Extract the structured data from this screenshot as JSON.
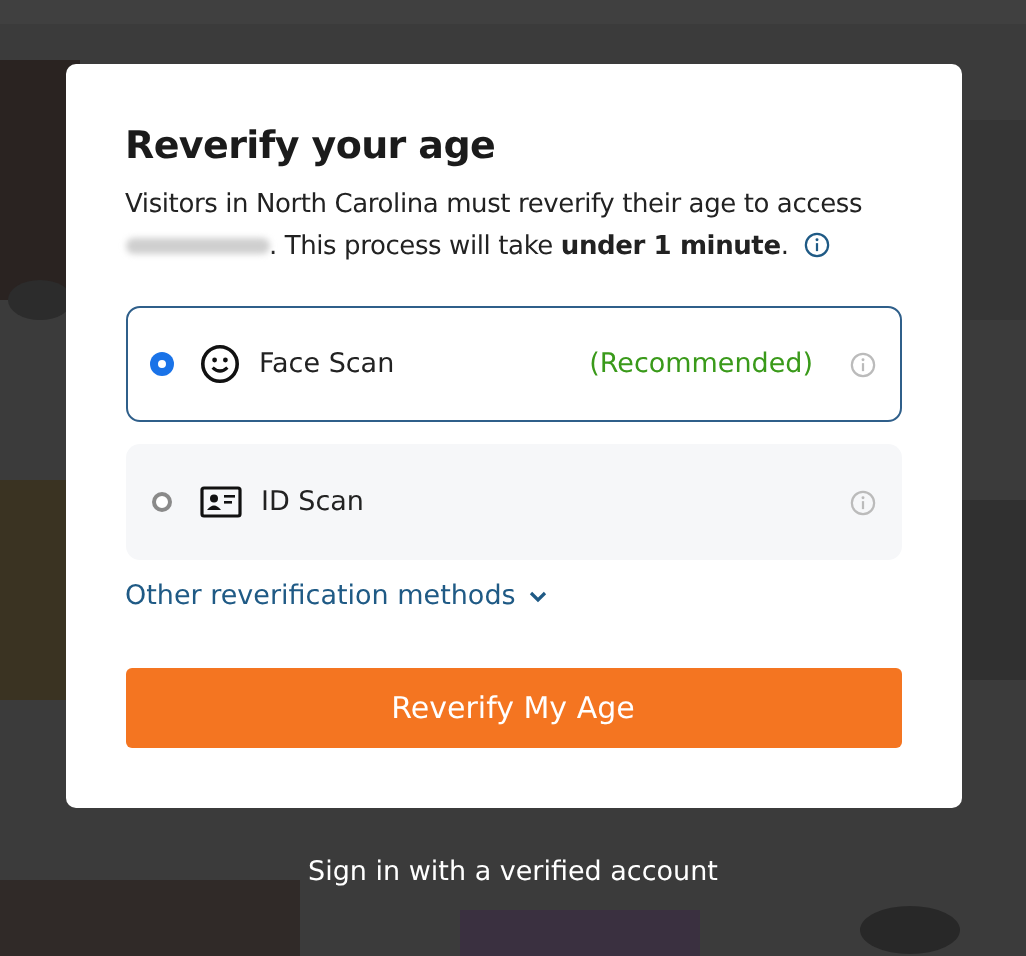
{
  "dialog": {
    "title": "Reverify your age",
    "description": {
      "before": "Visitors in North Carolina must reverify their age to access",
      "redacted_name": true,
      "after": ". This process will take **under 1 minute**."
    },
    "options": [
      {
        "kind": "face",
        "label": "Face Scan",
        "note": "(Recommended)",
        "selected": true
      },
      {
        "kind": "id",
        "label": "ID Scan",
        "selected": false
      }
    ],
    "more_link": "Other reverification methods",
    "primary_button": "Reverify My Age"
  },
  "sign_in_link": "Sign in with a verified account"
}
